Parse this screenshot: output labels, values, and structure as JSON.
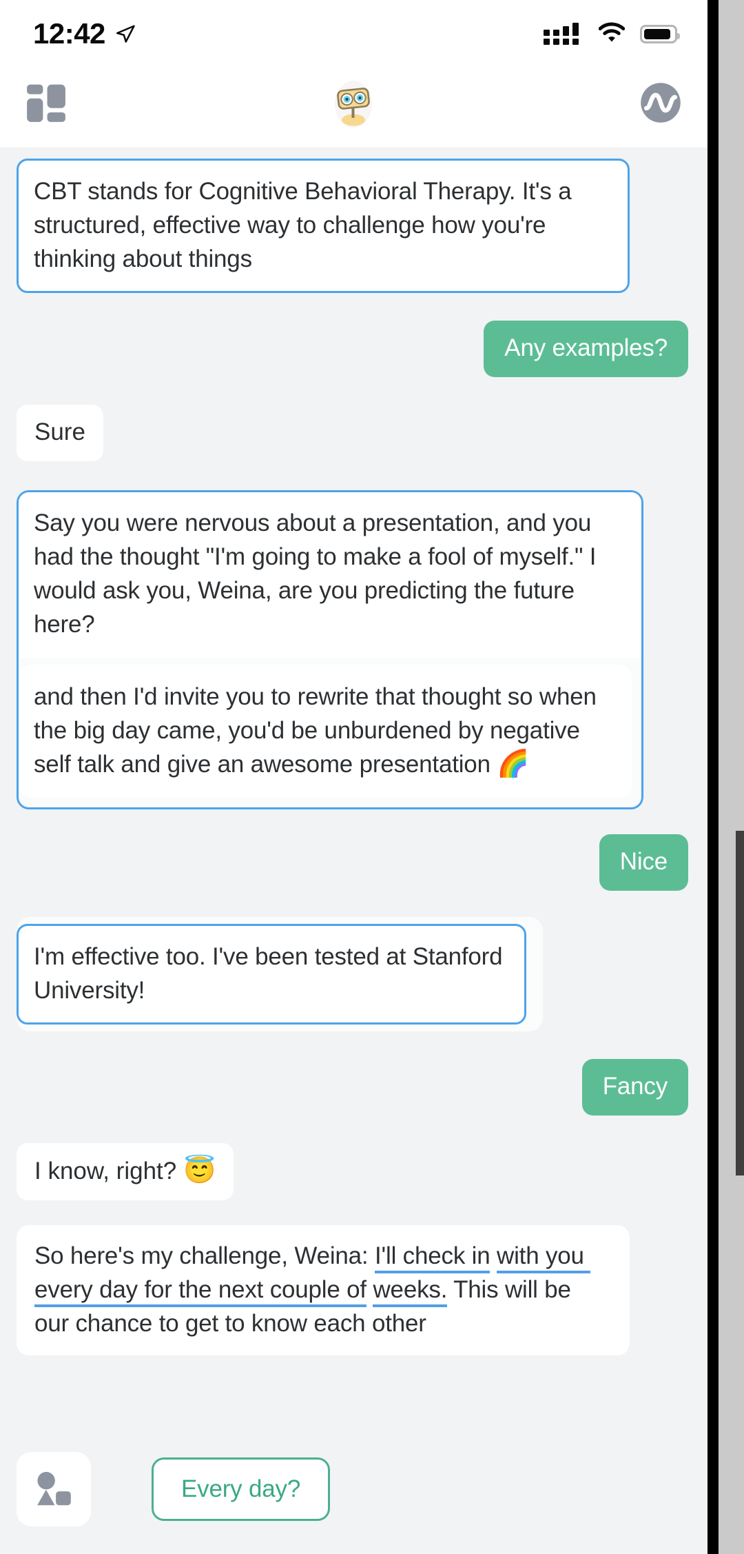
{
  "statusbar": {
    "time": "12:42",
    "location_icon": "location-arrow-icon",
    "signal_icon": "cellular-signal-icon",
    "wifi_icon": "wifi-icon",
    "battery_icon": "battery-icon"
  },
  "header": {
    "left_icon": "dashboard-grid-icon",
    "avatar_icon": "woebot-robot-avatar",
    "right_icon": "mood-waveform-icon"
  },
  "colors": {
    "bot_border": "#4da3ea",
    "user_bubble": "#5cbd95",
    "chip_border": "#4caf8e",
    "chip_text": "#3aa981",
    "chat_bg": "#f1f3f5",
    "underline": "#52a0e8"
  },
  "messages": [
    {
      "id": "msg-cbt-definition",
      "sender": "bot",
      "style": "outlined",
      "text": "CBT stands for Cognitive Behavioral Therapy. It's a structured, effective way to challenge how you're thinking about things"
    },
    {
      "id": "msg-any-examples",
      "sender": "user",
      "style": "green",
      "text": "Any examples?"
    },
    {
      "id": "msg-sure",
      "sender": "bot",
      "style": "plain",
      "text": "Sure"
    },
    {
      "id": "msg-presentation-example",
      "sender": "bot",
      "style": "outlined-group-top",
      "text": "Say you were nervous about a presentation, and you had the thought \"I'm going to make a fool of myself.\" I would ask you, Weina, are you predicting the future here?"
    },
    {
      "id": "msg-rewrite-thought",
      "sender": "bot",
      "style": "outlined-group-bottom",
      "text": "and then I'd invite you to rewrite that thought so when the big day came, you'd be unburdened by negative self talk and give an awesome presentation ",
      "emoji": "🌈"
    },
    {
      "id": "msg-nice",
      "sender": "user",
      "style": "green",
      "text": "Nice"
    },
    {
      "id": "msg-effective-stanford",
      "sender": "bot",
      "style": "outlined-card",
      "text": "I'm effective too. I've been tested at Stanford University!"
    },
    {
      "id": "msg-fancy",
      "sender": "user",
      "style": "green",
      "text": "Fancy"
    },
    {
      "id": "msg-i-know-right",
      "sender": "bot",
      "style": "plain",
      "text": "I know, right? ",
      "emoji": "😇"
    },
    {
      "id": "msg-challenge",
      "sender": "bot",
      "style": "plain-wide",
      "text_before": "So here's my challenge, Weina: ",
      "text_underlined_1": "I'll check in",
      "text_underlined_2": "with you every day for the next couple of",
      "text_underlined_3": "weeks.",
      "text_after": " This will be our chance to get to know each other"
    }
  ],
  "bottombar": {
    "shapes_button_icon": "shapes-picker-icon",
    "suggestion_chip": "Every day?"
  }
}
